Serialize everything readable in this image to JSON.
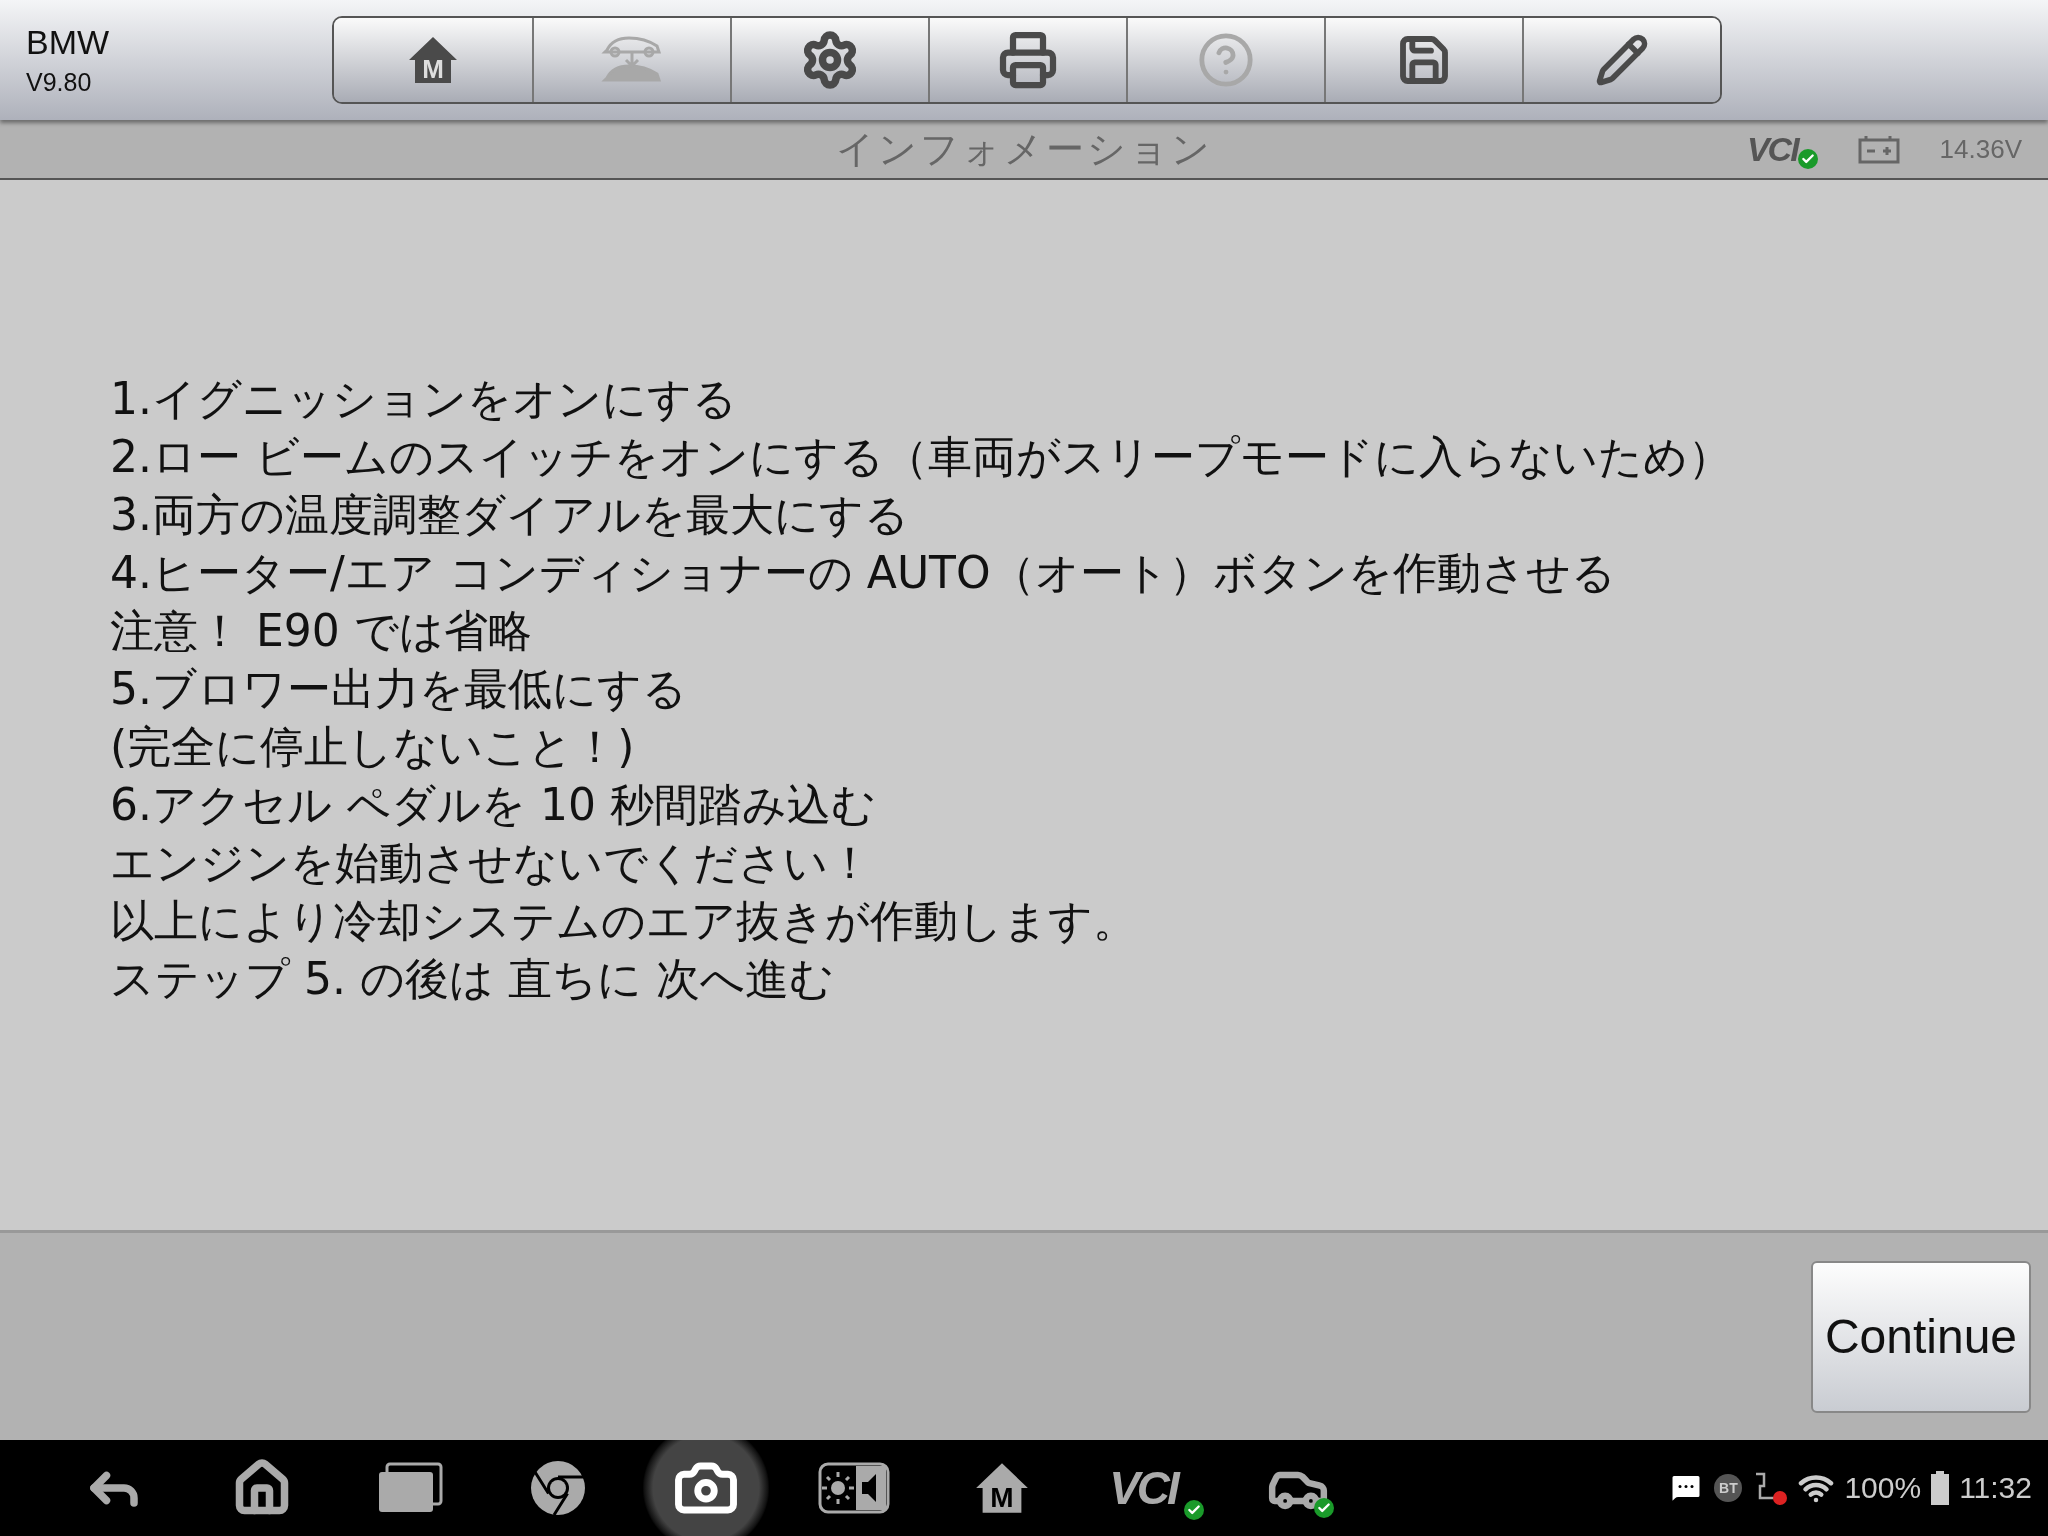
{
  "header": {
    "title": "BMW",
    "version": "V9.80"
  },
  "toolbar": [
    {
      "kind": "home",
      "label": "M",
      "disabled": false
    },
    {
      "kind": "transfer",
      "disabled": true
    },
    {
      "kind": "settings",
      "disabled": false
    },
    {
      "kind": "print",
      "disabled": false
    },
    {
      "kind": "help",
      "disabled": true
    },
    {
      "kind": "save",
      "disabled": false
    },
    {
      "kind": "edit",
      "disabled": false
    }
  ],
  "title_bar": {
    "title": "インフォメーション",
    "vci": "VCI",
    "vci_connected": true,
    "voltage": "14.36V"
  },
  "message_lines": [
    "1.イグニッションをオンにする",
    "2.ロー ビームのスイッチをオンにする（車両がスリープモードに入らないため）",
    "3.両方の温度調整ダイアルを最大にする",
    "4.ヒーター/エア コンディショナーの AUTO（オート）ボタンを作動させる",
    "注意！ E90 では省略",
    "5.ブロワー出力を最低にする",
    "(完全に停止しないこと！)",
    "6.アクセル ペダルを 10 秒間踏み込む",
    "エンジンを始動させないでください！",
    "以上により冷却システムのエア抜きが作動します。",
    "ステップ 5. の後は 直ちに 次へ進む"
  ],
  "continue_button": "Continue",
  "nav_bar": [
    {
      "kind": "back",
      "selected": false
    },
    {
      "kind": "home",
      "selected": false
    },
    {
      "kind": "recents",
      "selected": false
    },
    {
      "kind": "browser",
      "selected": false
    },
    {
      "kind": "camera",
      "selected": true
    },
    {
      "kind": "display",
      "selected": false
    },
    {
      "kind": "home-m",
      "label": "M",
      "selected": false
    },
    {
      "kind": "vci",
      "label": "VCI",
      "selected": false
    },
    {
      "kind": "car",
      "selected": false
    }
  ],
  "status_bar": {
    "bt": "BT",
    "battery": "100%",
    "time": "11:32"
  }
}
